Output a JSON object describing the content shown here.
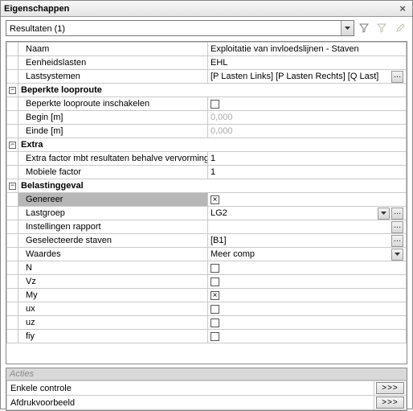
{
  "window": {
    "title": "Eigenschappen"
  },
  "toolbar": {
    "combo": "Resultaten (1)"
  },
  "rows": {
    "naam_l": "Naam",
    "naam_v": "Exploitatie van invloedslijnen - Staven",
    "eenh_l": "Eenheidslasten",
    "eenh_v": "EHL",
    "lsys_l": "Lastsystemen",
    "lsys_v": "[P Lasten Links] [P Lasten Rechts] [Q Last]",
    "beperkte": "Beperkte looproute",
    "binsch_l": "Beperkte looproute inschakelen",
    "begin_l": "Begin [m]",
    "begin_v": "0,000",
    "einde_l": "Einde [m]",
    "einde_v": "0,000",
    "extra": "Extra",
    "efac_l": "Extra factor mbt resultaten behalve vervormingen",
    "efac_v": "1",
    "mfac_l": "Mobiele factor",
    "mfac_v": "1",
    "belast": "Belastinggeval",
    "gen_l": "Genereer",
    "lg_l": "Lastgroep",
    "lg_v": "LG2",
    "ir_l": "Instellingen rapport",
    "gs_l": "Geselecteerde staven",
    "gs_v": "[B1]",
    "wa_l": "Waardes",
    "wa_v": "Meer comp",
    "n_l": "N",
    "vz_l": "Vz",
    "my_l": "My",
    "ux_l": "ux",
    "uz_l": "uz",
    "fiy_l": "fiy"
  },
  "actions": {
    "head": "Acties",
    "a1": "Enkele controle",
    "a2": "Afdrukvoorbeeld",
    "go": ">>>"
  }
}
